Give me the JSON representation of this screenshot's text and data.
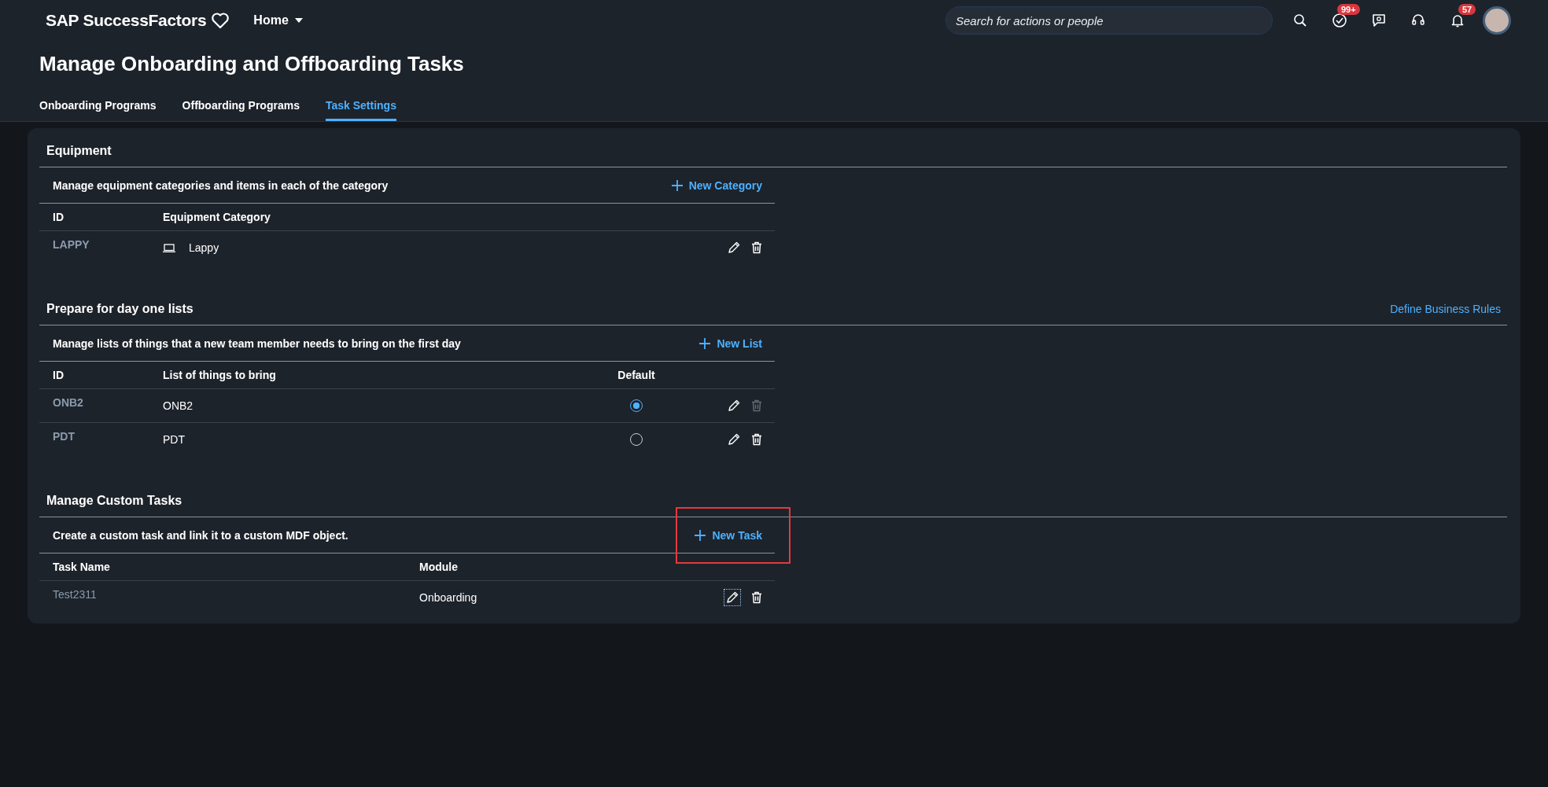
{
  "header": {
    "logo": "SAP SuccessFactors",
    "home_menu": "Home",
    "search": {
      "placeholder": "Search for actions or people"
    },
    "toolbar": [
      {
        "kind": "search"
      },
      {
        "kind": "todo",
        "badge": "99+"
      },
      {
        "kind": "chat"
      },
      {
        "kind": "support"
      },
      {
        "kind": "notifications",
        "badge": "57"
      },
      {
        "kind": "avatar"
      }
    ]
  },
  "page_title": "Manage Onboarding and Offboarding Tasks",
  "tabs": [
    {
      "label": "Onboarding Programs",
      "selected": false
    },
    {
      "label": "Offboarding Programs",
      "selected": false
    },
    {
      "label": "Task Settings",
      "selected": true
    }
  ],
  "equipment": {
    "title": "Equipment",
    "description": "Manage equipment categories and items in each of the category",
    "action": "New Category",
    "columns": [
      "ID",
      "Equipment Category"
    ],
    "rows": [
      {
        "id": "LAPPY",
        "category": "Lappy"
      }
    ]
  },
  "day_one_lists": {
    "title": "Prepare for day one lists",
    "link": "Define Business Rules",
    "description": "Manage lists of things that a new team member needs to bring on the first day",
    "action": "New List",
    "columns": [
      "ID",
      "List of things to bring",
      "Default"
    ],
    "rows": [
      {
        "id": "ONB2",
        "name": "ONB2",
        "selected": true,
        "delete_disabled": true
      },
      {
        "id": "PDT",
        "name": "PDT",
        "selected": false,
        "delete_disabled": false
      }
    ]
  },
  "custom_tasks": {
    "title": "Manage Custom Tasks",
    "description": "Create a custom task and link it to a custom MDF object.",
    "action": {
      "label": "New Task",
      "highlighted": true
    },
    "columns": [
      "Task Name",
      "Module"
    ],
    "rows": [
      {
        "name": "Test2311",
        "module": "Onboarding",
        "edit_focused": true
      }
    ]
  }
}
